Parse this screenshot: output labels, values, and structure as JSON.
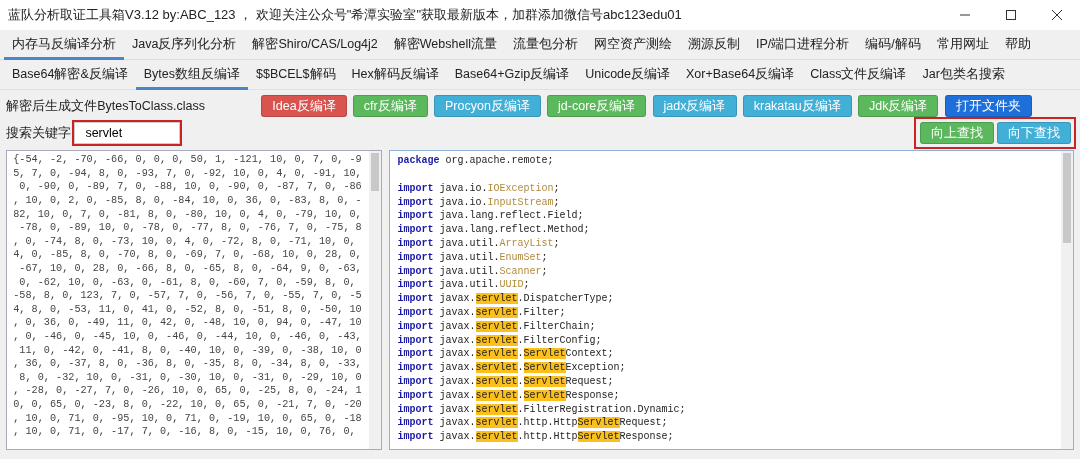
{
  "window": {
    "title": "蓝队分析取证工具箱V3.12 by:ABC_123 ，  欢迎关注公众号\"希潭实验室\"获取最新版本，加群添加微信号abc123edu01"
  },
  "main_tabs": [
    {
      "label": "内存马反编译分析",
      "selected": true
    },
    {
      "label": "Java反序列化分析",
      "selected": false
    },
    {
      "label": "解密Shiro/CAS/Log4j2",
      "selected": false
    },
    {
      "label": "解密Webshell流量",
      "selected": false
    },
    {
      "label": "流量包分析",
      "selected": false
    },
    {
      "label": "网空资产测绘",
      "selected": false
    },
    {
      "label": "溯源反制",
      "selected": false
    },
    {
      "label": "IP/端口进程分析",
      "selected": false
    },
    {
      "label": "编码/解码",
      "selected": false
    },
    {
      "label": "常用网址",
      "selected": false
    },
    {
      "label": "帮助",
      "selected": false
    }
  ],
  "sub_tabs": [
    {
      "label": "Base64解密&反编译",
      "selected": false
    },
    {
      "label": "Bytes数组反编译",
      "selected": true
    },
    {
      "label": "$$BCEL$解码",
      "selected": false
    },
    {
      "label": "Hex解码反编译",
      "selected": false
    },
    {
      "label": "Base64+Gzip反编译",
      "selected": false
    },
    {
      "label": "Unicode反编译",
      "selected": false
    },
    {
      "label": "Xor+Base64反编译",
      "selected": false
    },
    {
      "label": "Class文件反编译",
      "selected": false
    },
    {
      "label": "Jar包类名搜索",
      "selected": false
    }
  ],
  "output_note": "解密后生成文件BytesToClass.class",
  "decompile_buttons": [
    {
      "label": "Idea反编译",
      "kind": "danger"
    },
    {
      "label": "cfr反编译",
      "kind": "success"
    },
    {
      "label": "Procyon反编译",
      "kind": "info"
    },
    {
      "label": "jd-core反编译",
      "kind": "success"
    },
    {
      "label": "jadx反编译",
      "kind": "info"
    },
    {
      "label": "krakatau反编译",
      "kind": "info"
    },
    {
      "label": "Jdk反编译",
      "kind": "success"
    },
    {
      "label": "打开文件夹",
      "kind": "primary"
    }
  ],
  "search": {
    "label": "搜索关键字",
    "value": "servlet",
    "annotated": true
  },
  "find_buttons": {
    "annotated": true,
    "items": [
      {
        "label": "向上查找",
        "kind": "success"
      },
      {
        "label": "向下查找",
        "kind": "info"
      }
    ]
  },
  "bytes_lines": [
    "{-54, -2, -70, -66, 0, 0, 0, 50, 1, -121, 10, 0, 7, 0, -9",
    "5, 7, 0, -94, 8, 0, -93, 7, 0, -92, 10, 0, 4, 0, -91, 10,",
    " 0, -90, 0, -89, 7, 0, -88, 10, 0, -90, 0, -87, 7, 0, -86",
    ", 10, 0, 2, 0, -85, 8, 0, -84, 10, 0, 36, 0, -83, 8, 0, -",
    "82, 10, 0, 7, 0, -81, 8, 0, -80, 10, 0, 4, 0, -79, 10, 0,",
    " -78, 0, -89, 10, 0, -78, 0, -77, 8, 0, -76, 7, 0, -75, 8",
    ", 0, -74, 8, 0, -73, 10, 0, 4, 0, -72, 8, 0, -71, 10, 0,",
    "4, 0, -85, 8, 0, -70, 8, 0, -69, 7, 0, -68, 10, 0, 28, 0,",
    " -67, 10, 0, 28, 0, -66, 8, 0, -65, 8, 0, -64, 9, 0, -63,",
    " 0, -62, 10, 0, -63, 0, -61, 8, 0, -60, 7, 0, -59, 8, 0,",
    "-58, 8, 0, 123, 7, 0, -57, 7, 0, -56, 7, 0, -55, 7, 0, -5",
    "4, 8, 0, -53, 11, 0, 41, 0, -52, 8, 0, -51, 8, 0, -50, 10",
    ", 0, 36, 0, -49, 11, 0, 42, 0, -48, 10, 0, 94, 0, -47, 10",
    ", 0, -46, 0, -45, 10, 0, -46, 0, -44, 10, 0, -46, 0, -43,",
    " 11, 0, -42, 0, -41, 8, 0, -40, 10, 0, -39, 0, -38, 10, 0",
    ", 36, 0, -37, 8, 0, -36, 8, 0, -35, 8, 0, -34, 8, 0, -33,",
    " 8, 0, -32, 10, 0, -31, 0, -30, 10, 0, -31, 0, -29, 10, 0",
    ", -28, 0, -27, 7, 0, -26, 10, 0, 65, 0, -25, 8, 0, -24, 1",
    "0, 0, 65, 0, -23, 8, 0, -22, 10, 0, 65, 0, -21, 7, 0, -20",
    ", 10, 0, 71, 0, -95, 10, 0, 71, 0, -19, 10, 0, 65, 0, -18",
    ", 10, 0, 71, 0, -17, 7, 0, -16, 8, 0, -15, 10, 0, 76, 0,"
  ],
  "code_lines": [
    {
      "segments": [
        {
          "kind": "keyword",
          "text": "package"
        },
        {
          "kind": "plain",
          "text": " org.apache.remote;"
        }
      ]
    },
    {
      "gap_before": true,
      "segments": [
        {
          "kind": "keyword",
          "text": "import"
        },
        {
          "kind": "plain",
          "text": " java.io."
        },
        {
          "kind": "type",
          "text": "IOException"
        },
        {
          "kind": "plain",
          "text": ";"
        }
      ]
    },
    {
      "segments": [
        {
          "kind": "keyword",
          "text": "import"
        },
        {
          "kind": "plain",
          "text": " java.io."
        },
        {
          "kind": "type",
          "text": "InputStream"
        },
        {
          "kind": "plain",
          "text": ";"
        }
      ]
    },
    {
      "segments": [
        {
          "kind": "keyword",
          "text": "import"
        },
        {
          "kind": "plain",
          "text": " java.lang.reflect.Field;"
        }
      ]
    },
    {
      "segments": [
        {
          "kind": "keyword",
          "text": "import"
        },
        {
          "kind": "plain",
          "text": " java.lang.reflect.Method;"
        }
      ]
    },
    {
      "segments": [
        {
          "kind": "keyword",
          "text": "import"
        },
        {
          "kind": "plain",
          "text": " java.util."
        },
        {
          "kind": "type",
          "text": "ArrayList"
        },
        {
          "kind": "plain",
          "text": ";"
        }
      ]
    },
    {
      "segments": [
        {
          "kind": "keyword",
          "text": "import"
        },
        {
          "kind": "plain",
          "text": " java.util."
        },
        {
          "kind": "type",
          "text": "EnumSet"
        },
        {
          "kind": "plain",
          "text": ";"
        }
      ]
    },
    {
      "segments": [
        {
          "kind": "keyword",
          "text": "import"
        },
        {
          "kind": "plain",
          "text": " java.util."
        },
        {
          "kind": "type",
          "text": "Scanner"
        },
        {
          "kind": "plain",
          "text": ";"
        }
      ]
    },
    {
      "segments": [
        {
          "kind": "keyword",
          "text": "import"
        },
        {
          "kind": "plain",
          "text": " java.util."
        },
        {
          "kind": "type",
          "text": "UUID"
        },
        {
          "kind": "plain",
          "text": ";"
        }
      ]
    },
    {
      "segments": [
        {
          "kind": "keyword",
          "text": "import"
        },
        {
          "kind": "plain",
          "text": " javax."
        },
        {
          "kind": "match",
          "text": "servlet"
        },
        {
          "kind": "plain",
          "text": ".DispatcherType;"
        }
      ]
    },
    {
      "segments": [
        {
          "kind": "keyword",
          "text": "import"
        },
        {
          "kind": "plain",
          "text": " javax."
        },
        {
          "kind": "match",
          "text": "servlet"
        },
        {
          "kind": "plain",
          "text": ".Filter;"
        }
      ]
    },
    {
      "segments": [
        {
          "kind": "keyword",
          "text": "import"
        },
        {
          "kind": "plain",
          "text": " javax."
        },
        {
          "kind": "match",
          "text": "servlet"
        },
        {
          "kind": "plain",
          "text": ".FilterChain;"
        }
      ]
    },
    {
      "segments": [
        {
          "kind": "keyword",
          "text": "import"
        },
        {
          "kind": "plain",
          "text": " javax."
        },
        {
          "kind": "match",
          "text": "servlet"
        },
        {
          "kind": "plain",
          "text": ".FilterConfig;"
        }
      ]
    },
    {
      "segments": [
        {
          "kind": "keyword",
          "text": "import"
        },
        {
          "kind": "plain",
          "text": " javax."
        },
        {
          "kind": "match",
          "text": "servlet"
        },
        {
          "kind": "plain",
          "text": "."
        },
        {
          "kind": "match",
          "text": "Servlet"
        },
        {
          "kind": "plain",
          "text": "Context;"
        }
      ]
    },
    {
      "segments": [
        {
          "kind": "keyword",
          "text": "import"
        },
        {
          "kind": "plain",
          "text": " javax."
        },
        {
          "kind": "match",
          "text": "servlet"
        },
        {
          "kind": "plain",
          "text": "."
        },
        {
          "kind": "match",
          "text": "Servlet"
        },
        {
          "kind": "plain",
          "text": "Exception;"
        }
      ]
    },
    {
      "segments": [
        {
          "kind": "keyword",
          "text": "import"
        },
        {
          "kind": "plain",
          "text": " javax."
        },
        {
          "kind": "match",
          "text": "servlet"
        },
        {
          "kind": "plain",
          "text": "."
        },
        {
          "kind": "match",
          "text": "Servlet"
        },
        {
          "kind": "plain",
          "text": "Request;"
        }
      ]
    },
    {
      "segments": [
        {
          "kind": "keyword",
          "text": "import"
        },
        {
          "kind": "plain",
          "text": " javax."
        },
        {
          "kind": "match",
          "text": "servlet"
        },
        {
          "kind": "plain",
          "text": "."
        },
        {
          "kind": "match",
          "text": "Servlet"
        },
        {
          "kind": "plain",
          "text": "Response;"
        }
      ]
    },
    {
      "segments": [
        {
          "kind": "keyword",
          "text": "import"
        },
        {
          "kind": "plain",
          "text": " javax."
        },
        {
          "kind": "match",
          "text": "servlet"
        },
        {
          "kind": "plain",
          "text": ".FilterRegistration.Dynamic;"
        }
      ]
    },
    {
      "segments": [
        {
          "kind": "keyword",
          "text": "import"
        },
        {
          "kind": "plain",
          "text": " javax."
        },
        {
          "kind": "match",
          "text": "servlet"
        },
        {
          "kind": "plain",
          "text": ".http.Http"
        },
        {
          "kind": "match",
          "text": "Servlet"
        },
        {
          "kind": "plain",
          "text": "Request;"
        }
      ]
    },
    {
      "segments": [
        {
          "kind": "keyword",
          "text": "import"
        },
        {
          "kind": "plain",
          "text": " javax."
        },
        {
          "kind": "match",
          "text": "servlet"
        },
        {
          "kind": "plain",
          "text": ".http.Http"
        },
        {
          "kind": "match",
          "text": "Servlet"
        },
        {
          "kind": "plain",
          "text": "Response;"
        }
      ]
    }
  ]
}
